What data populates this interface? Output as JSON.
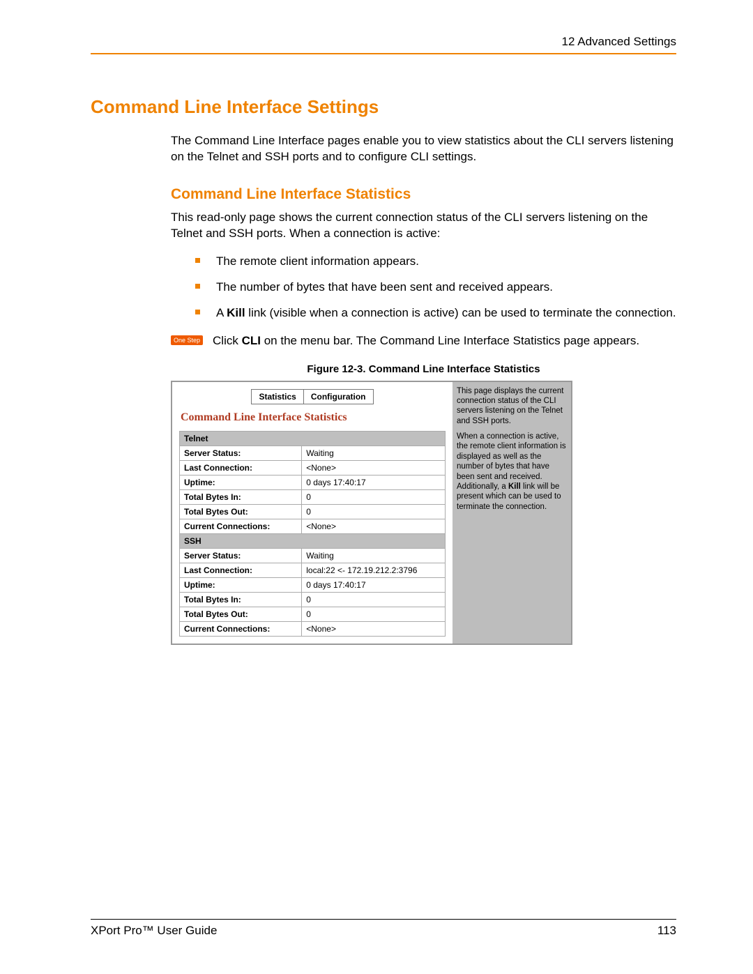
{
  "header": {
    "chapter": "12 Advanced Settings"
  },
  "h1": "Command Line Interface Settings",
  "intro": "The Command Line Interface pages enable you to view statistics about the CLI servers listening on the Telnet and SSH ports and to configure CLI settings.",
  "h2": "Command Line Interface Statistics",
  "para1": "This read-only page shows the current connection status of the CLI servers listening on the Telnet and SSH ports. When a connection is active:",
  "bullets": {
    "b1": "The remote client information appears.",
    "b2": "The number of bytes that have been sent and received appears.",
    "b3a": "A ",
    "b3bold": "Kill",
    "b3b": " link (visible when a connection is active) can be used to terminate the connection."
  },
  "step": {
    "badge": "One Step",
    "a": "Click ",
    "bold": "CLI",
    "b": " on the menu bar. The Command Line Interface Statistics page appears."
  },
  "figure": {
    "caption": "Figure 12-3. Command Line Interface Statistics",
    "tabs": {
      "t1": "Statistics",
      "t2": "Configuration"
    },
    "panel_title": "Command Line Interface Statistics",
    "sections": {
      "telnet": {
        "heading": "Telnet",
        "rows": {
          "r1l": "Server Status:",
          "r1v": "Waiting",
          "r2l": "Last Connection:",
          "r2v": "<None>",
          "r3l": "Uptime:",
          "r3v": "0 days 17:40:17",
          "r4l": "Total Bytes In:",
          "r4v": "0",
          "r5l": "Total Bytes Out:",
          "r5v": "0",
          "r6l": "Current Connections:",
          "r6v": "<None>"
        }
      },
      "ssh": {
        "heading": "SSH",
        "rows": {
          "r1l": "Server Status:",
          "r1v": "Waiting",
          "r2l": "Last Connection:",
          "r2v": "local:22 <- 172.19.212.2:3796",
          "r3l": "Uptime:",
          "r3v": "0 days 17:40:17",
          "r4l": "Total Bytes In:",
          "r4v": "0",
          "r5l": "Total Bytes Out:",
          "r5v": "0",
          "r6l": "Current Connections:",
          "r6v": "<None>"
        }
      }
    },
    "side": {
      "p1": "This page displays the current connection status of the CLI servers listening on the Telnet and SSH ports.",
      "p2a": "When a connection is active, the remote client information is displayed as well as the number of bytes that have been sent and received. Additionally, a ",
      "p2bold": "Kill",
      "p2b": " link will be present which can be used to terminate the connection."
    }
  },
  "footer": {
    "left": "XPort Pro™ User Guide",
    "right": "113"
  }
}
